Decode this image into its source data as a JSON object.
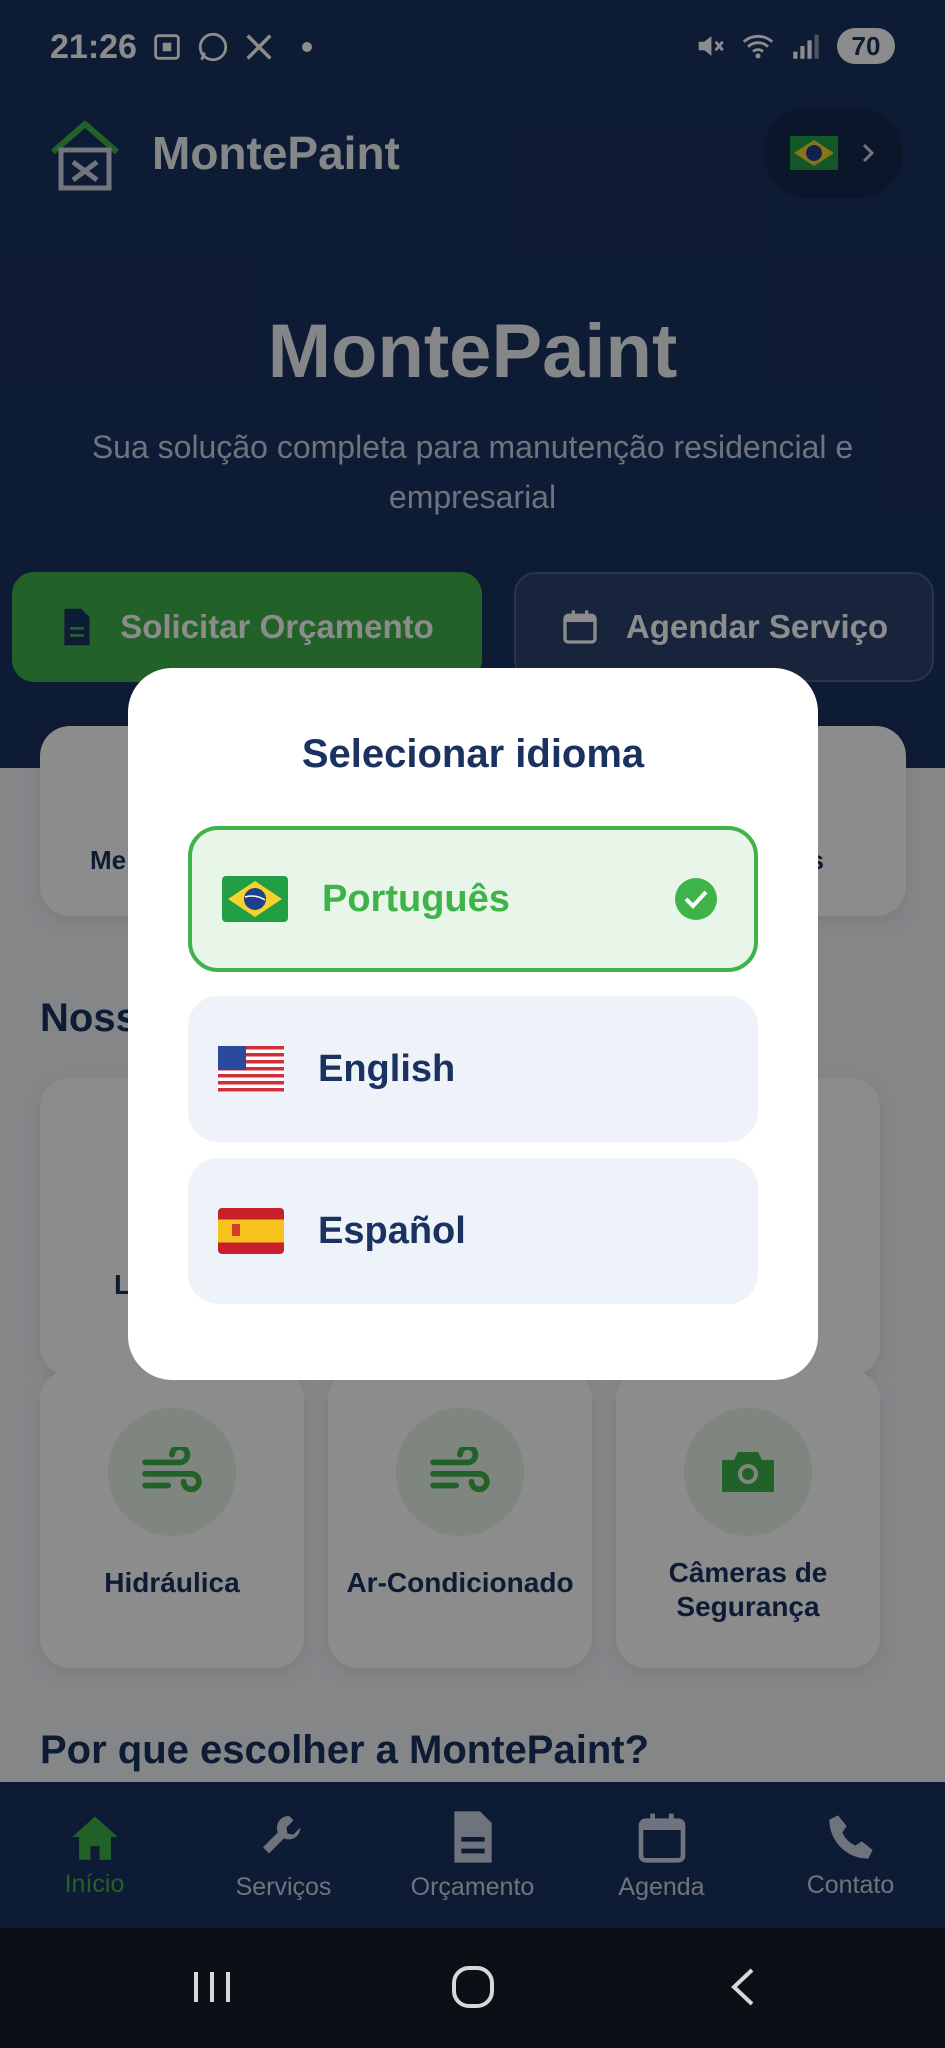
{
  "status_bar": {
    "time": "21:26",
    "battery": "70"
  },
  "header": {
    "brand": "MontePaint"
  },
  "hero": {
    "title": "MontePaint",
    "subtitle": "Sua solução completa para manutenção residencial e empresarial",
    "primary_button": "Solicitar Orçamento",
    "secondary_button": "Agendar Serviço"
  },
  "features": [
    "Me",
    "s"
  ],
  "sections": {
    "services_partial": "Noss",
    "why_title": "Por que escolher a MontePaint?"
  },
  "services": {
    "row1_partial": "L",
    "row2": [
      {
        "label": "Hidráulica",
        "icon": "wind-icon"
      },
      {
        "label": "Ar-Condicionado",
        "icon": "wind-icon"
      },
      {
        "label": "Câmeras de Segurança",
        "icon": "camera-icon"
      }
    ]
  },
  "bottom_nav": [
    {
      "label": "Início",
      "icon": "home-icon",
      "active": true
    },
    {
      "label": "Serviços",
      "icon": "wrench-icon"
    },
    {
      "label": "Orçamento",
      "icon": "document-icon"
    },
    {
      "label": "Agenda",
      "icon": "calendar-icon"
    },
    {
      "label": "Contato",
      "icon": "phone-icon"
    }
  ],
  "dialog": {
    "title": "Selecionar idioma",
    "options": [
      {
        "label": "Português",
        "flag": "brazil-flag",
        "selected": true
      },
      {
        "label": "English",
        "flag": "usa-flag"
      },
      {
        "label": "Español",
        "flag": "spain-flag"
      }
    ]
  },
  "colors": {
    "primary": "#1b3260",
    "accent": "#3eb34a"
  }
}
